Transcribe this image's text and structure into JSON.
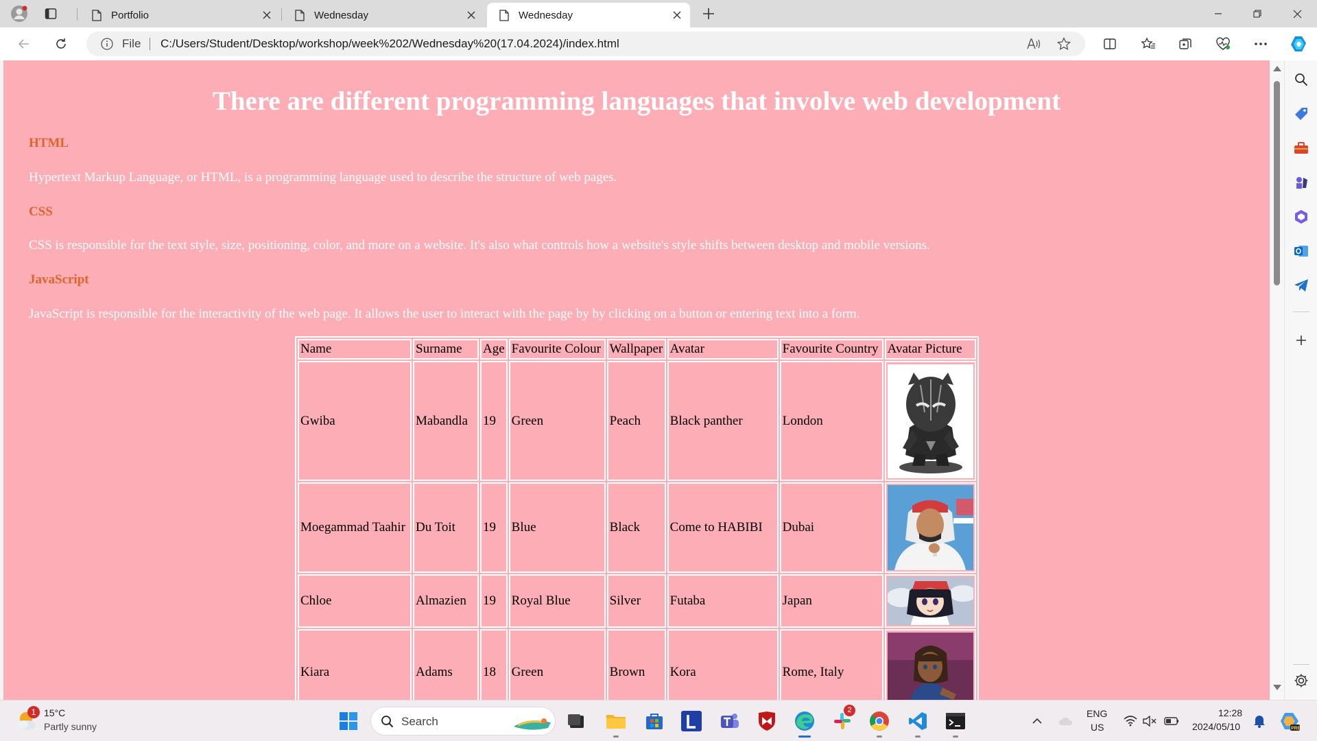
{
  "browser": {
    "tabs": [
      {
        "title": "Portfolio",
        "active": false
      },
      {
        "title": "Wednesday",
        "active": false
      },
      {
        "title": "Wednesday",
        "active": true
      }
    ],
    "address": {
      "scheme_label": "File",
      "url": "C:/Users/Student/Desktop/workshop/week%202/Wednesday%20(17.04.2024)/index.html"
    },
    "sidebar_icons": [
      "search-icon",
      "shopping-tag-icon",
      "toolbox-icon",
      "games-icon",
      "office-icon",
      "outlook-icon",
      "telegram-icon",
      "add-icon",
      "settings-icon"
    ]
  },
  "page": {
    "heading": "There are different programming languages that involve web development",
    "sections": [
      {
        "title": "HTML",
        "body": "Hypertext Markup Language, or HTML, is a programming language used to describe the structure of web pages."
      },
      {
        "title": "CSS",
        "body": "CSS is responsible for the text style, size, positioning, color, and more on a website. It's also what controls how a website's style shifts between desktop and mobile versions."
      },
      {
        "title": "JavaScript",
        "body": "JavaScript is responsible for the interactivity of the web page. It allows the user to interact with the page by by clicking on a button or entering text into a form."
      }
    ],
    "colors": {
      "background": "#fcadb6",
      "heading": "#ffffff",
      "subheading": "#e0642a"
    },
    "table": {
      "headers": [
        "Name",
        "Surname",
        "Age",
        "Favourite Colour",
        "Wallpaper",
        "Avatar",
        "Favourite Country",
        "Avatar Picture"
      ],
      "rows": [
        {
          "name": "Gwiba",
          "surname": "Mabandla",
          "age": "19",
          "colour": "Green",
          "wallpaper": "Peach",
          "avatar": "Black panther",
          "country": "London",
          "picture": "black-panther-avatar"
        },
        {
          "name": "Moegammad Taahir",
          "surname": "Du Toit",
          "age": "19",
          "colour": "Blue",
          "wallpaper": "Black",
          "avatar": "Come to HABIBI",
          "country": "Dubai",
          "picture": "habibi-avatar"
        },
        {
          "name": "Chloe",
          "surname": "Almazien",
          "age": "19",
          "colour": "Royal Blue",
          "wallpaper": "Silver",
          "avatar": "Futaba",
          "country": "Japan",
          "picture": "futaba-avatar"
        },
        {
          "name": "Kiara",
          "surname": "Adams",
          "age": "18",
          "colour": "Green",
          "wallpaper": "Brown",
          "avatar": "Kora",
          "country": "Rome, Italy",
          "picture": "kora-avatar"
        }
      ]
    }
  },
  "taskbar": {
    "weather": {
      "temp": "15°C",
      "condition": "Partly sunny",
      "badge": "1"
    },
    "search_placeholder": "Search",
    "apps": [
      "start-icon",
      "file-explorer-icon",
      "files-icon",
      "store-icon",
      "l-app-icon",
      "teams-icon",
      "mcafee-icon",
      "edge-icon",
      "slack-icon",
      "chrome-icon",
      "vscode-icon",
      "terminal-icon"
    ],
    "slack_badge": "2",
    "lang": {
      "line1": "ENG",
      "line2": "US"
    },
    "clock": {
      "time": "12:28",
      "date": "2024/05/10"
    }
  }
}
